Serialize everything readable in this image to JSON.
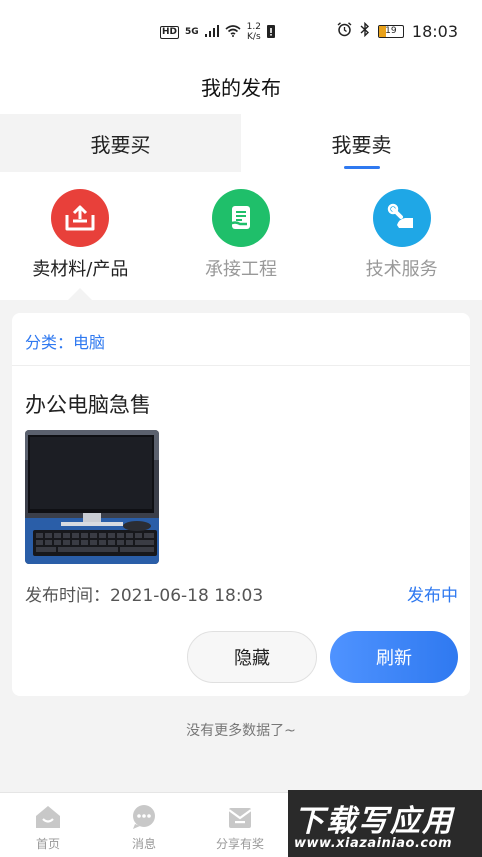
{
  "status_bar": {
    "hd": "HD",
    "network": "5G",
    "speed_value": "1.2",
    "speed_unit": "K/s",
    "battery": "19",
    "time": "18:03"
  },
  "nav": {
    "title": "我的发布"
  },
  "tabs": [
    {
      "label": "我要买",
      "active": false
    },
    {
      "label": "我要卖",
      "active": true
    }
  ],
  "categories": [
    {
      "label": "卖材料/产品",
      "icon": "upload-tray-icon",
      "color": "#e8403a",
      "active": true
    },
    {
      "label": "承接工程",
      "icon": "document-hand-icon",
      "color": "#1fbf6a",
      "active": false
    },
    {
      "label": "技术服务",
      "icon": "wrench-hand-icon",
      "color": "#1fa7e6",
      "active": false
    }
  ],
  "card": {
    "category": "分类：电脑",
    "title": "办公电脑急售",
    "image_alt": "computer-monitor-keyboard-photo",
    "time": "发布时间：2021-06-18 18:03",
    "status": "发布中",
    "hide_label": "隐藏",
    "refresh_label": "刷新"
  },
  "no_more_text": "没有更多数据了~",
  "tabbar": [
    {
      "label": "首页",
      "icon": "home-icon"
    },
    {
      "label": "消息",
      "icon": "message-icon"
    },
    {
      "label": "分享有奖",
      "icon": "gift-envelope-icon"
    }
  ],
  "watermark": {
    "top": "下载写应用",
    "bottom": "www.xiazainiao.com"
  }
}
